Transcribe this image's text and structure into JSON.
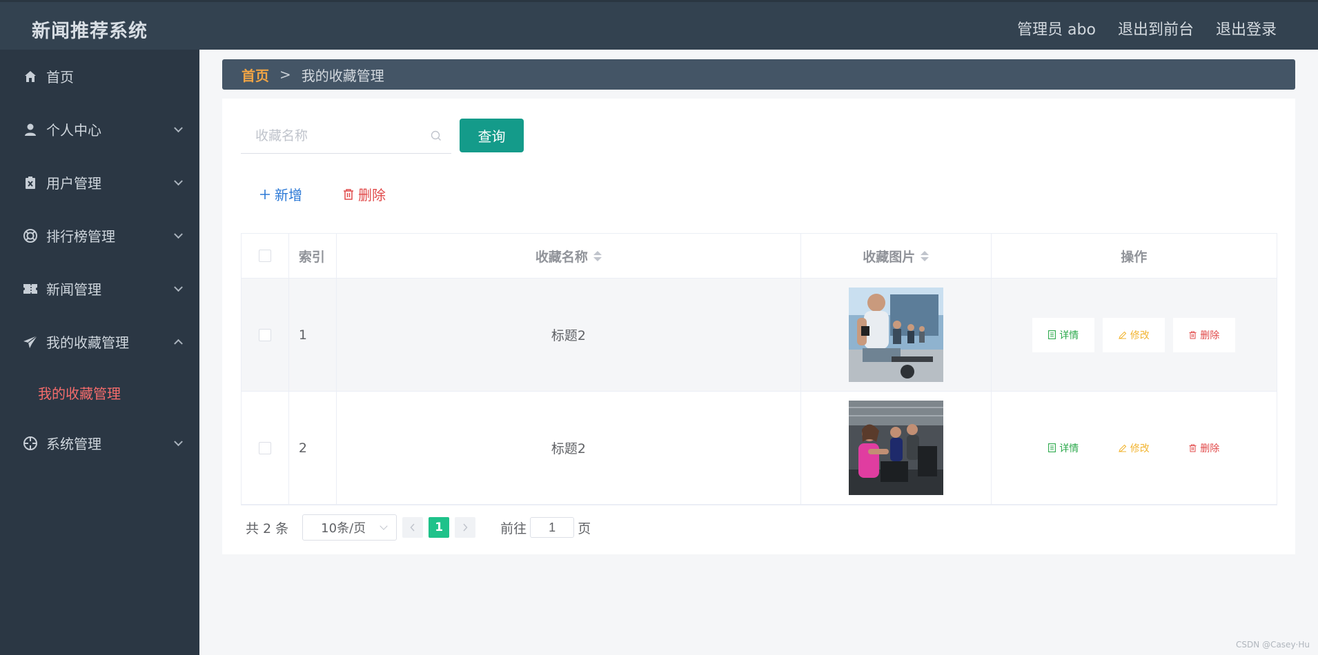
{
  "header": {
    "title": "新闻推荐系统",
    "links": [
      "管理员 abo",
      "退出到前台",
      "退出登录"
    ]
  },
  "sidebar": {
    "items": [
      {
        "label": "首页",
        "icon": "home-icon"
      },
      {
        "label": "个人中心",
        "icon": "user-icon"
      },
      {
        "label": "用户管理",
        "icon": "clipboard-icon"
      },
      {
        "label": "排行榜管理",
        "icon": "lifebuoy-icon"
      },
      {
        "label": "新闻管理",
        "icon": "ticket-icon"
      },
      {
        "label": "我的收藏管理",
        "icon": "paper-plane-icon",
        "expanded": true,
        "children": [
          "我的收藏管理"
        ]
      },
      {
        "label": "系统管理",
        "icon": "crosshair-icon"
      }
    ]
  },
  "breadcrumb": {
    "home": "首页",
    "separator": ">",
    "current": "我的收藏管理"
  },
  "search": {
    "placeholder": "收藏名称",
    "value": "",
    "button": "查询"
  },
  "toolbar": {
    "add": "新增",
    "delete": "删除"
  },
  "table": {
    "headers": [
      "索引",
      "收藏名称",
      "收藏图片",
      "操作"
    ],
    "rows": [
      {
        "index": "1",
        "name": "标题2",
        "image": "gym-man-cycling"
      },
      {
        "index": "2",
        "name": "标题2",
        "image": "gym-women-cycling"
      }
    ],
    "actions": [
      "详情",
      "修改",
      "删除"
    ]
  },
  "pagination": {
    "total": "共 2 条",
    "page_size": "10条/页",
    "current_page": "1",
    "goto_prefix": "前往",
    "goto_value": "1",
    "goto_suffix": "页"
  },
  "watermark": "CSDN @Casey·Hu",
  "colors": {
    "header_bg": "#334250",
    "sidebar_bg": "#2b3744",
    "breadcrumb_bg": "#445566",
    "primary_button": "#149b8a",
    "active_menu_text": "#f56c6c",
    "current_page": "#1fc28a"
  }
}
